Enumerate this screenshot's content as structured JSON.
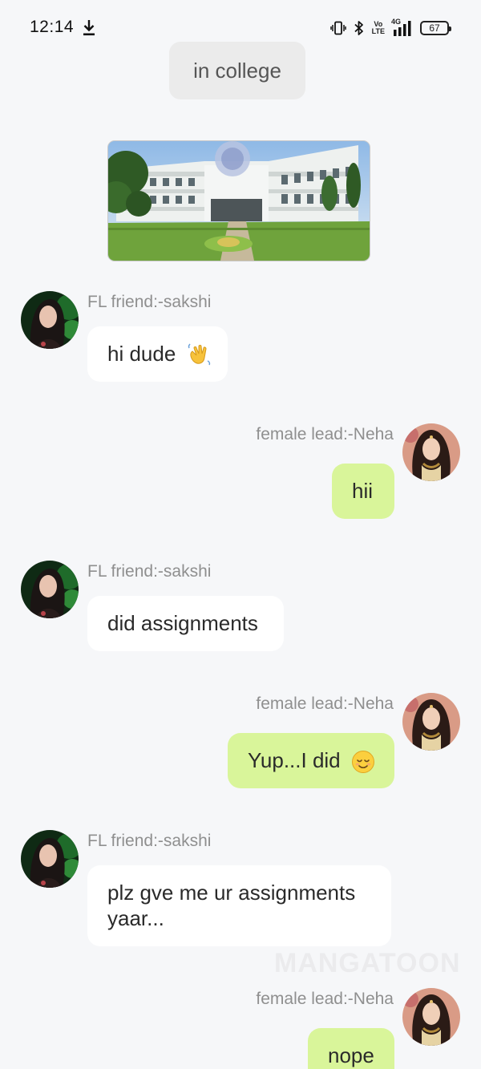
{
  "status_bar": {
    "time": "12:14",
    "battery": "67",
    "volte_top": "Vo",
    "volte_bottom": "LTE",
    "network": "4G"
  },
  "scene": {
    "label": "in college"
  },
  "characters": {
    "friend": "FL friend:-sakshi",
    "lead": "female lead:-Neha"
  },
  "messages": [
    {
      "side": "left",
      "sender": "FL friend:-sakshi",
      "text": "hi dude",
      "emoji": "waving-hand-emoji"
    },
    {
      "side": "right",
      "sender": "female lead:-Neha",
      "text": "hii"
    },
    {
      "side": "left",
      "sender": "FL friend:-sakshi",
      "text": "did assignments"
    },
    {
      "side": "right",
      "sender": "female lead:-Neha",
      "text": "Yup...I did",
      "emoji": "relieved-face-emoji"
    },
    {
      "side": "left",
      "sender": "FL friend:-sakshi",
      "text": "plz gve me ur assignments yaar..."
    },
    {
      "side": "right",
      "sender": "female lead:-Neha",
      "text": "nope"
    }
  ],
  "watermark": "MANGATOON",
  "colors": {
    "background": "#f6f7f9",
    "right_bubble": "#d9f59a",
    "left_bubble": "#ffffff",
    "name_text": "#8f8f8f"
  }
}
